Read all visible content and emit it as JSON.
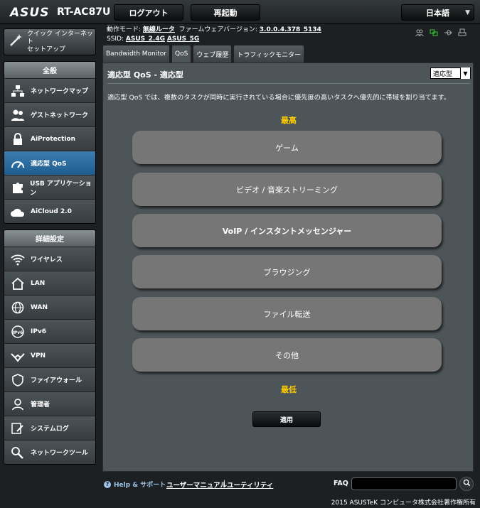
{
  "header": {
    "brand": "ASUS",
    "model": "RT-AC87U",
    "logout_label": "ログアウト",
    "reboot_label": "再起動",
    "language": "日本語"
  },
  "status": {
    "mode_label": "動作モード:",
    "mode_value": "無線ルータ",
    "firmware_label": "ファームウェアバージョン:",
    "firmware_value": "3.0.0.4.378_5134",
    "ssid_label": "SSID:",
    "ssid_24": "ASUS_2.4G",
    "ssid_5": "ASUS_5G"
  },
  "sidebar": {
    "quick_setup_line1": "クイック インターネット",
    "quick_setup_line2": "セットアップ",
    "general_header": "全般",
    "general_items": [
      {
        "label": "ネットワークマップ"
      },
      {
        "label": "ゲストネットワーク"
      },
      {
        "label": "AiProtection"
      },
      {
        "label": "適応型 QoS"
      },
      {
        "label": "USB アプリケーション"
      },
      {
        "label": "AiCloud 2.0"
      }
    ],
    "advanced_header": "詳細設定",
    "advanced_items": [
      {
        "label": "ワイヤレス"
      },
      {
        "label": "LAN"
      },
      {
        "label": "WAN"
      },
      {
        "label": "IPv6"
      },
      {
        "label": "VPN"
      },
      {
        "label": "ファイアウォール"
      },
      {
        "label": "管理者"
      },
      {
        "label": "システムログ"
      },
      {
        "label": "ネットワークツール"
      }
    ]
  },
  "tabs": [
    "Bandwidth Monitor",
    "QoS",
    "ウェブ履歴",
    "トラフィックモニター"
  ],
  "main": {
    "title": "適応型 QoS - 適応型",
    "mode_select": "適応型",
    "description": "適応型 QoS では、複数のタスクが同時に実行されている場合に優先度の高いタスクへ優先的に帯域を割り当てます。",
    "highest_label": "最高",
    "lowest_label": "最低",
    "categories": [
      "ゲーム",
      "ビデオ / 音楽ストリーミング",
      "VoIP / インスタントメッセンジャー",
      "ブラウジング",
      "ファイル転送",
      "その他"
    ],
    "apply_label": "適用"
  },
  "footer": {
    "help_label": "Help & サポート",
    "manual_link": "ユーザーマニュアル",
    "separator": "|",
    "utility_link": "ユーティリティ",
    "faq_label": "FAQ",
    "copyright": "2015 ASUSTeK コンピュータ株式会社著作権所有"
  }
}
